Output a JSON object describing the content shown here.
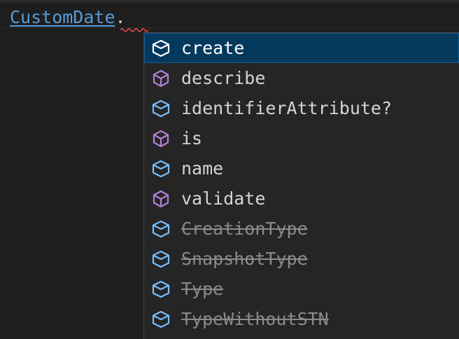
{
  "editor": {
    "identifier": "CustomDate",
    "trigger_char": "."
  },
  "colors": {
    "background": "#1e1e1e",
    "widget_background": "#252526",
    "selection": "#04395e",
    "field_icon": "#75beff",
    "method_icon": "#b180d7",
    "identifier": "#569cd6",
    "error_squiggle": "#f14c4c",
    "deprecated_text": "#8a8a8a"
  },
  "suggestions": [
    {
      "label": "create",
      "icon": "property-icon",
      "deprecated": false,
      "selected": true
    },
    {
      "label": "describe",
      "icon": "method-icon",
      "deprecated": false,
      "selected": false
    },
    {
      "label": "identifierAttribute?",
      "icon": "property-icon",
      "deprecated": false,
      "selected": false
    },
    {
      "label": "is",
      "icon": "method-icon",
      "deprecated": false,
      "selected": false
    },
    {
      "label": "name",
      "icon": "property-icon",
      "deprecated": false,
      "selected": false
    },
    {
      "label": "validate",
      "icon": "method-icon",
      "deprecated": false,
      "selected": false
    },
    {
      "label": "CreationType",
      "icon": "property-icon",
      "deprecated": true,
      "selected": false
    },
    {
      "label": "SnapshotType",
      "icon": "property-icon",
      "deprecated": true,
      "selected": false
    },
    {
      "label": "Type",
      "icon": "property-icon",
      "deprecated": true,
      "selected": false
    },
    {
      "label": "TypeWithoutSTN",
      "icon": "property-icon",
      "deprecated": true,
      "selected": false
    }
  ]
}
